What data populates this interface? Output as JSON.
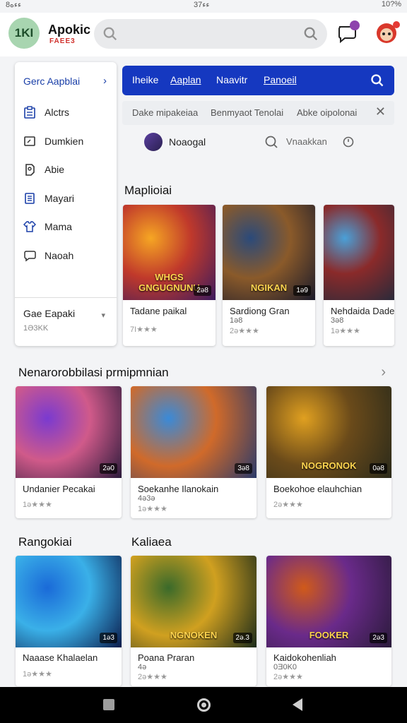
{
  "status": {
    "left": "ءءه8",
    "center": "ءء37",
    "right": "10?%"
  },
  "header": {
    "logo": "1KI",
    "brand": "Apokic",
    "brand_sub": "FAEE3",
    "search_placeholder": ""
  },
  "sidebar": {
    "title": "Gerc Aapblai",
    "items": [
      {
        "label": "Alctrs",
        "icon": "clipboard-icon"
      },
      {
        "label": "Dumkien",
        "icon": "box-icon"
      },
      {
        "label": "Abie",
        "icon": "tag-icon"
      },
      {
        "label": "Mayari",
        "icon": "document-icon"
      },
      {
        "label": "Mama",
        "icon": "shirt-icon"
      },
      {
        "label": "Naoah",
        "icon": "chat-icon"
      }
    ],
    "footer": {
      "label": "Gae Eapaki",
      "sub": "1Ə3KK"
    }
  },
  "tabs": [
    {
      "label": "Iheike",
      "underlined": false
    },
    {
      "label": "Aaplan",
      "underlined": true
    },
    {
      "label": "Naavitr",
      "underlined": false
    },
    {
      "label": "Panoeil",
      "underlined": true
    }
  ],
  "chips": [
    "Dake mipakeiaa",
    "Benmyaot Tenolai",
    "Abke oipolonai"
  ],
  "user": {
    "name": "Noaogal",
    "view": "Vnaakkan"
  },
  "sections": {
    "top": {
      "title": "Maplioiai",
      "cards": [
        {
          "title": "Tadane paikal",
          "sub": "",
          "rating": "7I★★★",
          "corner": "2ǝ8",
          "art": "WHGS GNGUGNUNU",
          "colors": [
            "#f6a623",
            "#c0392b",
            "#3b1b5e"
          ]
        },
        {
          "title": "Sardiong Gran",
          "sub": "1ə8",
          "rating": "2ǝ★★★",
          "corner": "1ǝ9",
          "art": "NGIKAN",
          "colors": [
            "#2b4a7a",
            "#8a5a2a",
            "#1a1a2a"
          ]
        },
        {
          "title": "Nehdaida Dadek",
          "sub": "3ǝ8",
          "rating": "1ǝ★★★",
          "corner": "",
          "art": "",
          "colors": [
            "#4aa0d8",
            "#8a2a2a",
            "#2a2a3a"
          ]
        }
      ]
    },
    "middle": {
      "title": "Nenarorobbilasi prmipmnian",
      "cards": [
        {
          "title": "Undanier Pecakai",
          "sub": "",
          "rating": "1ə★★★",
          "corner": "2ə0",
          "art": "",
          "colors": [
            "#7a3ad0",
            "#d05a8a",
            "#2a1a3a"
          ]
        },
        {
          "title": "Soekanhe Ilanokain",
          "sub": "4ə3ə",
          "rating": "1ǝ★★★",
          "corner": "3ə8",
          "art": "",
          "colors": [
            "#3a8ad8",
            "#d06a2a",
            "#2a3a6a"
          ]
        },
        {
          "title": "Boekohoe elauhchian",
          "sub": "",
          "rating": "2ǝ★★★",
          "corner": "0ǝ8",
          "art": "NOGRONOK",
          "colors": [
            "#e0a020",
            "#6a4a1a",
            "#2a2a1a"
          ]
        }
      ]
    },
    "bottom": {
      "title_left": "Rangokiai",
      "title_right": "Kaliaea",
      "cards": [
        {
          "title": "Naaase Khalaelan",
          "sub": "",
          "rating": "1ǝ★★★",
          "corner": "1ǝ3",
          "art": "",
          "colors": [
            "#1a6ad8",
            "#3ab0e8",
            "#0a1a4a"
          ]
        },
        {
          "title": "Poana Praran",
          "sub": "4ǝ",
          "rating": "2ǝ★★★",
          "corner": "2ǝ.3",
          "art": "NGNOKEN",
          "colors": [
            "#3a6a2a",
            "#d0a020",
            "#1a2a1a"
          ]
        },
        {
          "title": "Kaidokohenliah",
          "sub": "0Ǝ0K0",
          "rating": "2ǝ★★★",
          "corner": "2ǝ3",
          "art": "FOOKER",
          "colors": [
            "#d05a1a",
            "#6a2a8a",
            "#2a1a3a"
          ]
        }
      ]
    }
  },
  "icons": [
    "search-icon",
    "chat-bubble-icon",
    "profile-icon",
    "chevron-right-icon",
    "close-icon",
    "clock-icon",
    "home-icon",
    "back-icon",
    "square-icon"
  ],
  "colors": {
    "accent": "#1538c0",
    "logo_bg": "#a8d5b0",
    "badge": "#e53935"
  }
}
